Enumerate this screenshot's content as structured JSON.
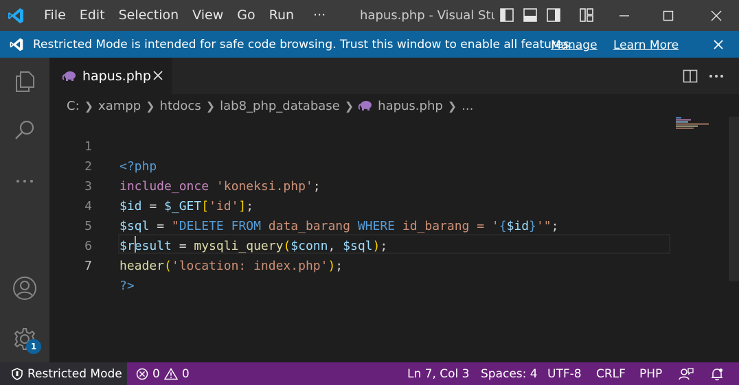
{
  "titlebar": {
    "menu": [
      "File",
      "Edit",
      "Selection",
      "View",
      "Go",
      "Run",
      "···"
    ],
    "window_title": "hapus.php - Visual Studio Code",
    "brand_color": "#0065a9"
  },
  "banner": {
    "text": "Restricted Mode is intended for safe code browsing. Trust this window to enable all features.",
    "manage": "Manage",
    "learn_more": "Learn More"
  },
  "tab": {
    "label": "hapus.php",
    "icon": "php-elephant-icon"
  },
  "breadcrumb": {
    "items": [
      "C:",
      "xampp",
      "htdocs",
      "lab8_php_database",
      "hapus.php",
      "..."
    ]
  },
  "editor": {
    "lines": [
      "1",
      "2",
      "3",
      "4",
      "5",
      "6",
      "7"
    ],
    "code": {
      "l1": [
        "<?php"
      ],
      "l2": [
        "include_once",
        " ",
        "'koneksi.php'",
        ";"
      ],
      "l3": [
        "$id",
        " = ",
        "$_GET",
        "[",
        "'id'",
        "];"
      ],
      "l4": [
        "$sql",
        " = ",
        "\"DELETE FROM",
        " data_barang ",
        "WHERE",
        " id_barang = ",
        "'",
        "{",
        "$id",
        "}",
        "'\"",
        ";"
      ],
      "l5": [
        "$result",
        " = ",
        "mysqli_query",
        "(",
        "$conn",
        ", ",
        "$sql",
        ");"
      ],
      "l6": [
        "header",
        "(",
        "'location: index.php'",
        ");"
      ],
      "l7": [
        "?>"
      ]
    },
    "active_line": 7
  },
  "activity": {
    "badge": "1"
  },
  "statusbar": {
    "restricted": "Restricted Mode",
    "errors": "0",
    "warnings": "0",
    "position": "Ln 7, Col 3",
    "spaces": "Spaces: 4",
    "encoding": "UTF-8",
    "eol": "CRLF",
    "language": "PHP",
    "bg_color": "#68217a"
  }
}
